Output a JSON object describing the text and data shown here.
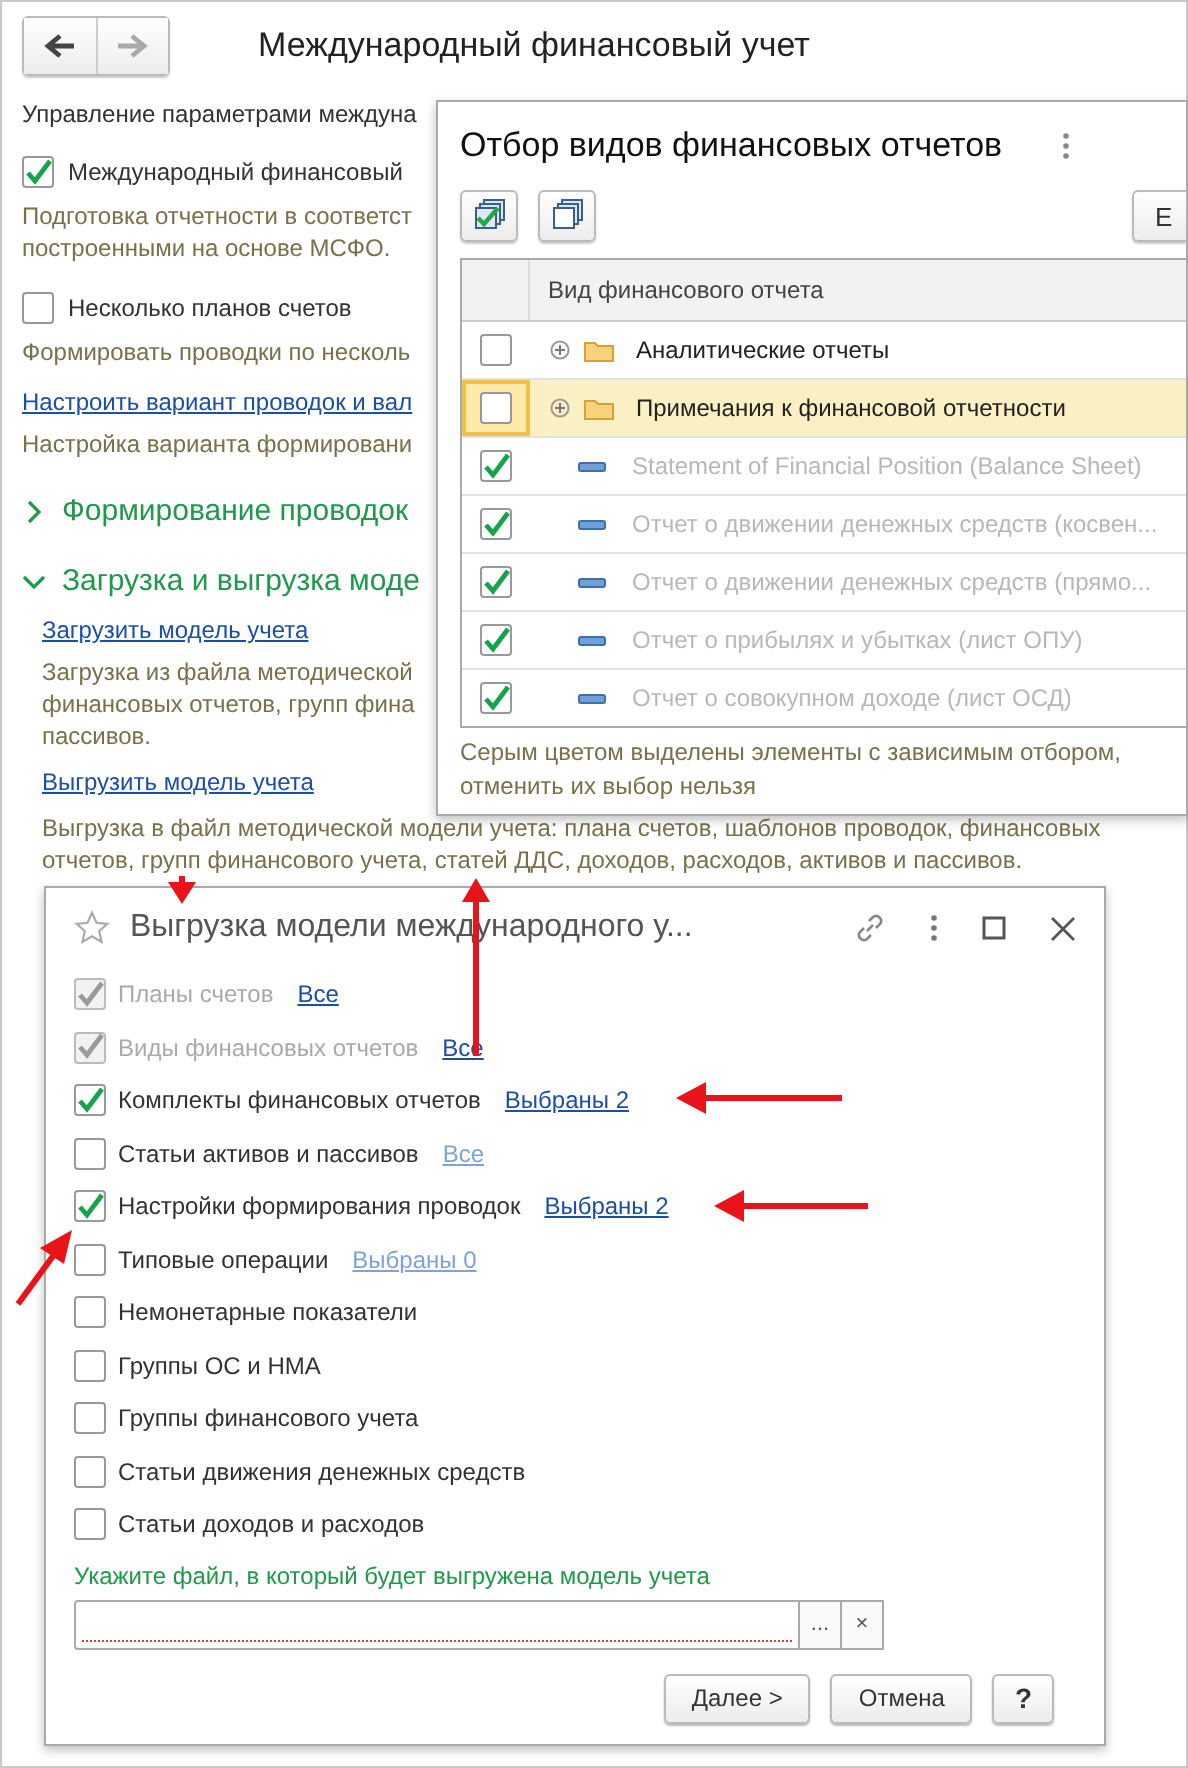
{
  "main": {
    "title": "Международный финансовый учет",
    "nav_buttons": [
      {
        "kind": "back",
        "disabled": false
      },
      {
        "kind": "forward",
        "disabled": true
      }
    ],
    "items": [
      {
        "kind": "text",
        "text": "Управление параметрами междуна"
      },
      {
        "kind": "checkbox",
        "label": "Международный финансовый",
        "checked": true
      },
      {
        "kind": "note",
        "text": "Подготовка отчетности в соответст\nпостроенными на основе МСФО."
      },
      {
        "kind": "checkbox",
        "label": "Несколько планов счетов",
        "checked": false
      },
      {
        "kind": "note",
        "text": "Формировать проводки по несколь"
      },
      {
        "kind": "link",
        "text": "Настроить вариант проводок и вал"
      },
      {
        "kind": "note",
        "text": "Настройка варианта формировани"
      },
      {
        "kind": "section",
        "label": "Формирование проводок",
        "expanded": false
      },
      {
        "kind": "section",
        "label": "Загрузка и выгрузка моде",
        "expanded": true,
        "children": [
          {
            "kind": "link",
            "text": "Загрузить модель учета"
          },
          {
            "kind": "note",
            "text": "Загрузка из файла методической\nфинансовых отчетов, групп фина\nпассивов."
          },
          {
            "kind": "link",
            "text": "Выгрузить модель учета"
          },
          {
            "kind": "note",
            "text": "Выгрузка в файл методической модели учета: плана счетов, шаблонов проводок, финансовых\nотчетов, групп финансового учета, статей ДДС, доходов, расходов, активов и пассивов."
          }
        ]
      }
    ]
  },
  "filter_popup": {
    "title": "Отбор видов финансовых отчетов",
    "cut_button": "Е",
    "table": {
      "columns": [
        "Вид финансового отчета"
      ],
      "rows": [
        {
          "kind": "group",
          "name": "Аналитические отчеты",
          "checked": false,
          "disabled": false,
          "selected": false
        },
        {
          "kind": "group",
          "name": "Примечания к финансовой отчетности",
          "checked": false,
          "disabled": false,
          "selected": true
        },
        {
          "kind": "item",
          "name": "Statement of Financial Position (Balance Sheet)",
          "checked": true,
          "disabled": true,
          "selected": false
        },
        {
          "kind": "item",
          "name": "Отчет о движении денежных средств (косвен...",
          "checked": true,
          "disabled": true,
          "selected": false
        },
        {
          "kind": "item",
          "name": "Отчет о движении денежных средств (прямо...",
          "checked": true,
          "disabled": true,
          "selected": false
        },
        {
          "kind": "item",
          "name": "Отчет о прибылях и убытках  (лист ОПУ)",
          "checked": true,
          "disabled": true,
          "selected": false
        },
        {
          "kind": "item",
          "name": "Отчет о совокупном доходе  (лист ОСД)",
          "checked": true,
          "disabled": true,
          "selected": false
        }
      ]
    },
    "footnote": "Серым цветом выделены элементы с зависимым отбором,\nотменить их выбор нельзя"
  },
  "export_dialog": {
    "title": "Выгрузка модели международного у...",
    "options": [
      {
        "label": "Планы счетов",
        "checked": true,
        "disabled": true,
        "link": "Все"
      },
      {
        "label": "Виды финансовых отчетов",
        "checked": true,
        "disabled": true,
        "link": "Все"
      },
      {
        "label": "Комплекты финансовых отчетов",
        "checked": true,
        "disabled": false,
        "link": "Выбраны 2"
      },
      {
        "label": "Статьи активов и пассивов",
        "checked": false,
        "disabled": false,
        "link": "Все"
      },
      {
        "label": "Настройки формирования проводок",
        "checked": true,
        "disabled": false,
        "link": "Выбраны 2"
      },
      {
        "label": "Типовые операции",
        "checked": false,
        "disabled": false,
        "link": "Выбраны 0"
      },
      {
        "label": "Немонетарные показатели",
        "checked": false,
        "disabled": false
      },
      {
        "label": "Группы ОС и НМА",
        "checked": false,
        "disabled": false
      },
      {
        "label": "Группы финансового учета",
        "checked": false,
        "disabled": false
      },
      {
        "label": "Статьи движения денежных средств",
        "checked": false,
        "disabled": false
      },
      {
        "label": "Статьи доходов и расходов",
        "checked": false,
        "disabled": false
      }
    ],
    "file_label": "Укажите файл, в который будет выгружена модель учета",
    "file_field": {
      "required": true,
      "select_button": "...",
      "clear_button": "×"
    },
    "buttons": [
      {
        "label": "Далее >"
      },
      {
        "label": "Отмена"
      },
      {
        "label": "?"
      }
    ]
  }
}
